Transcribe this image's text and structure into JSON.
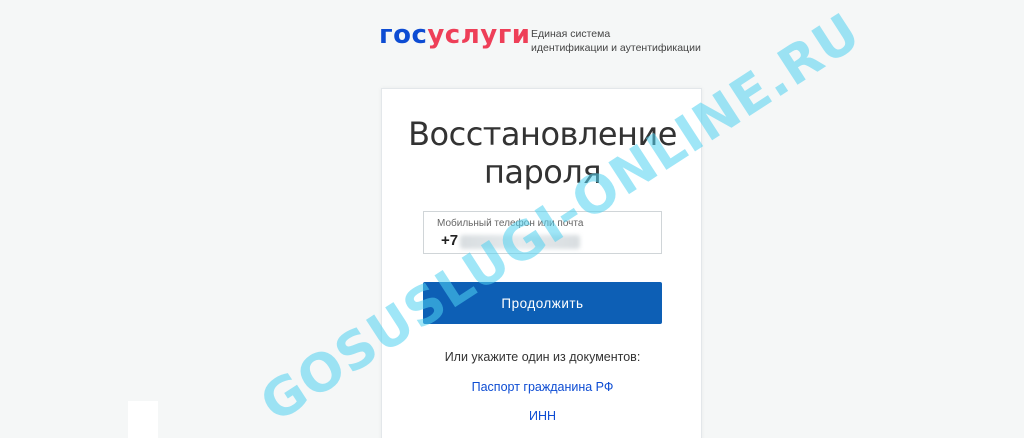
{
  "header": {
    "logo_part1": "гос",
    "logo_part2": "услуги",
    "tagline_line1": "Единая система",
    "tagline_line2": "идентификации и аутентификации"
  },
  "card": {
    "title": "Восстановление пароля",
    "field": {
      "label": "Мобильный телефон или почта",
      "value": "+7"
    },
    "continue_label": "Продолжить",
    "alt_text": "Или укажите один из документов:",
    "links": {
      "passport": "Паспорт гражданина РФ",
      "inn": "ИНН"
    }
  },
  "watermark": "GOSUSLUGI-ONLINE.RU",
  "colors": {
    "brand_blue": "#0d4cd3",
    "brand_red": "#ee3f58",
    "button_blue": "#0d5fb5",
    "watermark": "#50d2f0"
  }
}
